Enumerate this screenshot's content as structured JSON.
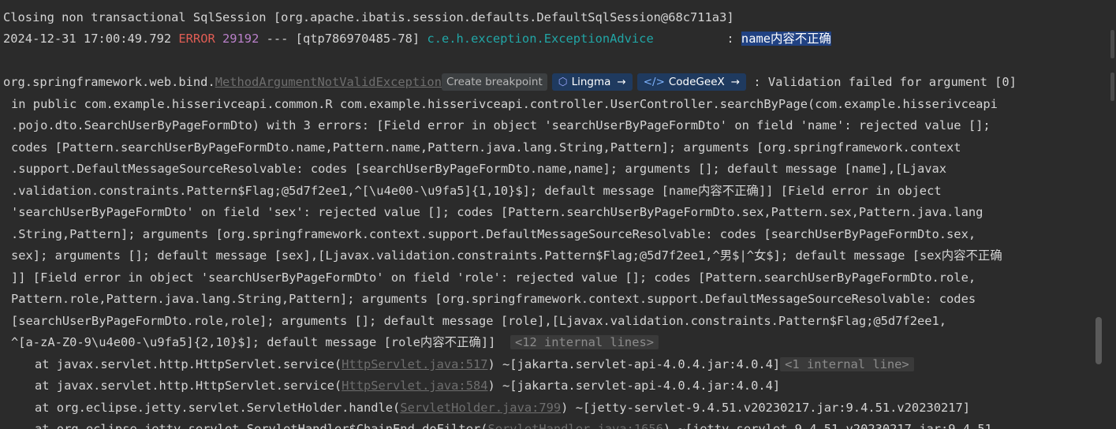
{
  "log": {
    "line1": "Closing non transactional SqlSession [org.apache.ibatis.session.defaults.DefaultSqlSession@68c711a3]",
    "line2": {
      "timestamp": "2024-12-31 17:00:49.792 ",
      "level": "ERROR",
      "pid": " 29192",
      "thread": " --- [qtp786970485-78] ",
      "logger": "c.e.h.exception.ExceptionAdvice",
      "sep": "          : ",
      "message": "name内容不正确"
    },
    "exception": {
      "pkg": "org.springframework.web.bind.",
      "cls": "MethodArgumentNotValidException",
      "create_breakpoint": "Create breakpoint",
      "lingma_label": "Lingma",
      "codegeex_label": "CodeGeeX",
      "rest": " : Validation failed for argument [0]"
    },
    "wrapped": [
      "in public com.example.hisserivceapi.common.R com.example.hisserivceapi.controller.UserController.searchByPage(com.example.hisserivceapi",
      ".pojo.dto.SearchUserByPageFormDto) with 3 errors: [Field error in object 'searchUserByPageFormDto' on field 'name': rejected value [];",
      "codes [Pattern.searchUserByPageFormDto.name,Pattern.name,Pattern.java.lang.String,Pattern]; arguments [org.springframework.context",
      ".support.DefaultMessageSourceResolvable: codes [searchUserByPageFormDto.name,name]; arguments []; default message [name],[Ljavax",
      ".validation.constraints.Pattern$Flag;@5d7f2ee1,^[\\u4e00-\\u9fa5]{1,10}$]; default message [name内容不正确]] [Field error in object",
      "'searchUserByPageFormDto' on field 'sex': rejected value []; codes [Pattern.searchUserByPageFormDto.sex,Pattern.sex,Pattern.java.lang",
      ".String,Pattern]; arguments [org.springframework.context.support.DefaultMessageSourceResolvable: codes [searchUserByPageFormDto.sex,",
      "sex]; arguments []; default message [sex],[Ljavax.validation.constraints.Pattern$Flag;@5d7f2ee1,^男$|^女$]; default message [sex内容不正确",
      "]] [Field error in object 'searchUserByPageFormDto' on field 'role': rejected value []; codes [Pattern.searchUserByPageFormDto.role,",
      "Pattern.role,Pattern.java.lang.String,Pattern]; arguments [org.springframework.context.support.DefaultMessageSourceResolvable: codes",
      "[searchUserByPageFormDto.role,role]; arguments []; default message [role],[Ljavax.validation.constraints.Pattern$Flag;@5d7f2ee1,"
    ],
    "last_wrapped": "^[a-zA-Z0-9\\u4e00-\\u9fa5]{2,10}$]; default message [role内容不正确]] ",
    "internal12": "<12 internal lines>",
    "stack": [
      {
        "prefix": "at javax.servlet.http.HttpServlet.service(",
        "link": "HttpServlet.java:517",
        "suffix": ") ~[jakarta.servlet-api-4.0.4.jar:4.0.4]",
        "fold": "<1 internal line>"
      },
      {
        "prefix": "at javax.servlet.http.HttpServlet.service(",
        "link": "HttpServlet.java:584",
        "suffix": ") ~[jakarta.servlet-api-4.0.4.jar:4.0.4]",
        "fold": ""
      },
      {
        "prefix": "at org.eclipse.jetty.servlet.ServletHolder.handle(",
        "link": "ServletHolder.java:799",
        "suffix": ") ~[jetty-servlet-9.4.51.v20230217.jar:9.4.51.v20230217]",
        "fold": ""
      },
      {
        "prefix": "at org.eclipse.jetty.servlet.ServletHandler$ChainEnd.doFilter(",
        "link": "ServletHandler.java:1656",
        "suffix": ") ~[jetty-servlet-9.4.51.v20230217.jar:9.4.51",
        "fold": ""
      }
    ]
  },
  "colors": {
    "background": "#2b2b2b",
    "error": "#e05d54",
    "pid": "#b980c9",
    "logger": "#21a6a6",
    "selection": "#214283"
  }
}
